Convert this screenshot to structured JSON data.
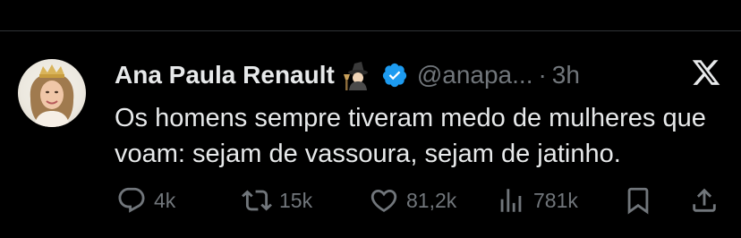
{
  "tweet": {
    "author_name": "Ana Paula Renault",
    "handle": "@anapa...",
    "separator": "·",
    "time": "3h",
    "text": "Os homens sempre tiveram medo de mulheres que voam: sejam de vassoura, sejam de jatinho.",
    "badge_icon": "verified-badge-icon",
    "emoji_icon": "witch-emoji-icon"
  },
  "actions": {
    "replies": "4k",
    "reposts": "15k",
    "likes": "81,2k",
    "views": "781k"
  },
  "colors": {
    "background": "#000000",
    "text": "#e7e9ea",
    "muted": "#71767b",
    "verified": "#1d9bf0"
  }
}
